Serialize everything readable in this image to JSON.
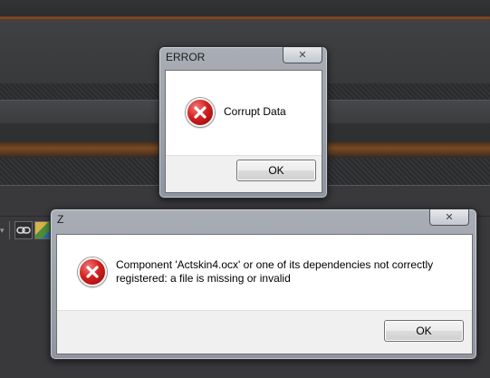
{
  "background": {
    "accent_orange": "#8a4f22",
    "toolbar_icons": [
      "link-icon",
      "image-icon"
    ]
  },
  "dialog_error": {
    "title": "ERROR",
    "close_symbol": "✕",
    "icon": "error-icon",
    "message": "Corrupt Data",
    "ok_label": "OK"
  },
  "dialog_z": {
    "title": "Z",
    "close_symbol": "✕",
    "icon": "error-icon",
    "message_line1": "Component 'Actskin4.ocx' or one of its dependencies not correctly",
    "message_line2": "registered: a file is missing or invalid",
    "ok_label": "OK"
  },
  "colors": {
    "error_red": "#d42020",
    "window_frame": "#a9aeb6"
  }
}
